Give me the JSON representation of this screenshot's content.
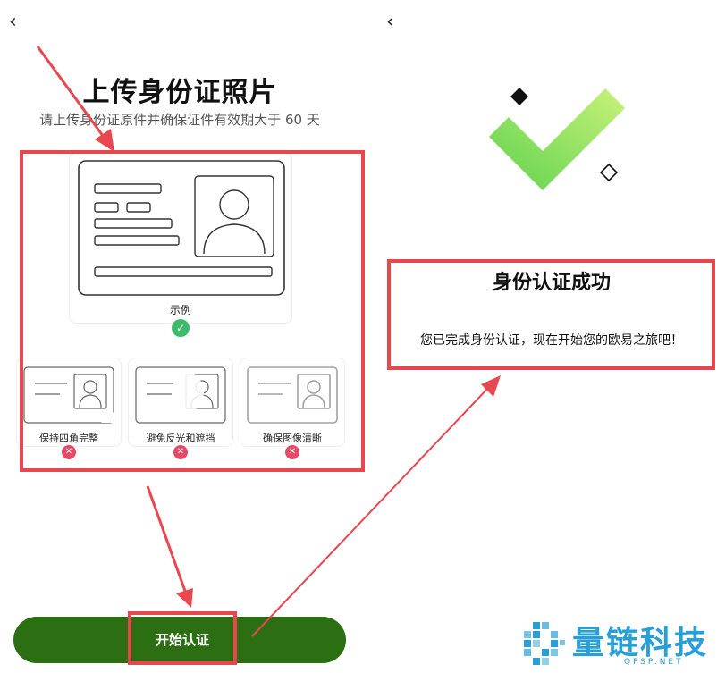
{
  "left_screen": {
    "back_glyph": "‹",
    "title": "上传身份证照片",
    "subtitle": "请上传身份证原件并确保证件有效期大于 60 天",
    "sample_label": "示例",
    "sample_status": "✓",
    "tips": [
      {
        "label": "保持四角完整",
        "status": "✕"
      },
      {
        "label": "避免反光和遮挡",
        "status": "✕"
      },
      {
        "label": "确保图像清晰",
        "status": "✕"
      }
    ],
    "start_button_label": "开始认证"
  },
  "right_screen": {
    "back_glyph": "‹",
    "success_title": "身份认证成功",
    "success_message": "您已完成身份认证，现在开始您的欧易之旅吧！"
  },
  "watermark": {
    "name": "量链科技",
    "sub": "QFSP.NET"
  },
  "colors": {
    "annotation_red": "#e8474f",
    "button_green": "#2c6e12",
    "ok_green": "#3dbb6a",
    "error_pink": "#e74967",
    "check_green": "#8ad65a",
    "brand_blue": "#2a9fd6"
  },
  "icons": [
    "back-arrow-icon",
    "id-card-icon",
    "check-badge-icon",
    "cross-badge-icon",
    "success-check-icon",
    "diamond-icon",
    "brand-logo-icon"
  ]
}
